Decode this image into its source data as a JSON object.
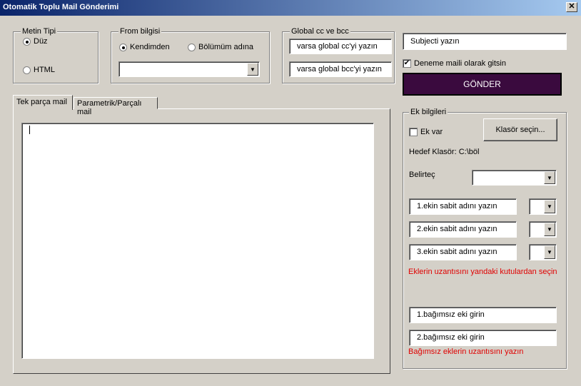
{
  "window": {
    "title": "Otomatik Toplu Mail Gönderimi",
    "close": "✕"
  },
  "metin_tipi": {
    "label": "Metin Tipi",
    "options": [
      "Düz",
      "HTML"
    ],
    "selected": "Düz"
  },
  "from": {
    "label": "From bilgisi",
    "options": [
      "Kendimden",
      "Bölümüm adına"
    ],
    "selected": "Kendimden",
    "dropdown_value": ""
  },
  "global_cc": {
    "label": "Global cc ve bcc",
    "cc_value": "varsa global cc'yi yazın",
    "bcc_value": "varsa global bcc'yi yazın"
  },
  "subject": {
    "value": "Subjecti yazın"
  },
  "test_mail": {
    "label": "Deneme maili olarak gitsin",
    "checked": true
  },
  "send_button": {
    "label": "GÖNDER"
  },
  "tabs": [
    "Tek parça mail",
    "Parametrik/Parçalı mail"
  ],
  "body_text": "",
  "ek_bilgileri": {
    "label": "Ek bilgileri",
    "ek_var": {
      "label": "Ek var",
      "checked": false
    },
    "folder_button": "Klasör seçin...",
    "target_folder": "Hedef Klasör: C:\\böl",
    "belirtec_label": "Belirteç",
    "belirtec_value": "",
    "fixed_attachments": [
      {
        "value": "1.ekin sabit adını yazın",
        "ext": ""
      },
      {
        "value": "2.ekin sabit adını yazın",
        "ext": ""
      },
      {
        "value": "3.ekin sabit adını yazın",
        "ext": ""
      }
    ],
    "ext_hint": "Eklerin uzantısını yandaki kutulardan seçin",
    "independent_attachments": [
      "1.bağımsız eki girin",
      "2.bağımsız eki girin"
    ],
    "independent_hint": "Bağımsız eklerin uzantısını yazın"
  },
  "colors": {
    "titlebar_start": "#0a246a",
    "send_button_bg": "#3a0a3e",
    "hint_red": "#e00000",
    "window_bg": "#d4d0c8"
  }
}
